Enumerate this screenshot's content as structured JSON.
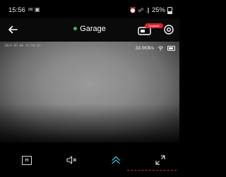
{
  "status_bar": {
    "time": "15:56",
    "left_icons": "✉ ▣",
    "right_icons": "⏰ ☍ .∥",
    "battery": "25%"
  },
  "header": {
    "title": "Garage",
    "online_color": "#3fc04f",
    "badge_text": "Upgrade",
    "back_icon": "arrow-left-icon",
    "cloud_icon": "cloud-storage-icon",
    "settings_icon": "gear-icon"
  },
  "video": {
    "osd_timestamp": "2023-05-06 15:56:21",
    "bitrate": "33.0KB/s"
  },
  "controls": {
    "hd_label": "H",
    "mute_icon": "speaker-muted-icon",
    "ptz_icon": "chevron-double-up-icon",
    "fullscreen_icon": "fullscreen-icon"
  }
}
